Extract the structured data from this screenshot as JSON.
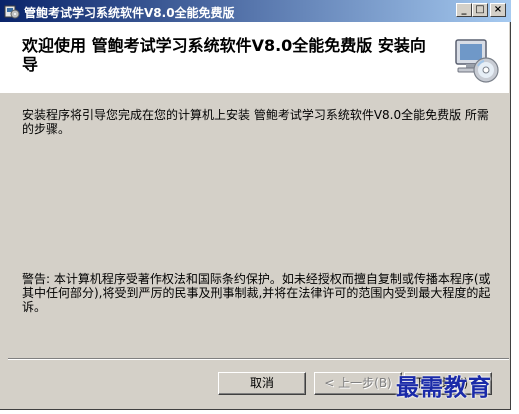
{
  "window": {
    "title": "管鲍考试学习系统软件V8.0全能免费版",
    "controls": {
      "minimize": "_",
      "maximize": "□",
      "close": "×"
    }
  },
  "header": {
    "title": "欢迎使用 管鲍考试学习系统软件V8.0全能免费版 安装向导",
    "icon": "computer-cd-icon"
  },
  "body": {
    "intro": "安装程序将引导您完成在您的计算机上安装 管鲍考试学习系统软件V8.0全能免费版 所需的步骤。",
    "warning": "警告: 本计算机程序受著作权法和国际条约保护。如未经授权而擅自复制或传播本程序(或其中任何部分),将受到严厉的民事及刑事制裁,并将在法律许可的范围内受到最大程度的起诉。"
  },
  "buttons": {
    "cancel": "取消",
    "back": "< 上一步(B)",
    "next": "下一步(N) >"
  },
  "watermark": "最需教育",
  "colors": {
    "titlebar_start": "#0a246a",
    "titlebar_end": "#a6caf0",
    "face": "#d4d0c8"
  }
}
